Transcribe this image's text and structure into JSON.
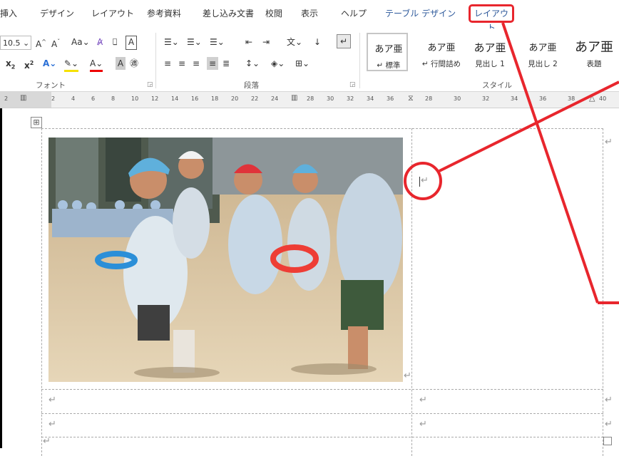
{
  "tabs": {
    "insert": "挿入",
    "design": "デザイン",
    "layout": "レイアウト",
    "references": "参考資料",
    "mailings": "差し込み文書",
    "review": "校閲",
    "view": "表示",
    "help": "ヘルプ",
    "table_design": "テーブル デザイン",
    "table_layout": "レイアウト"
  },
  "ribbon": {
    "font_size": "10.5",
    "font_group": "フォント",
    "paragraph_group": "段落",
    "style_group": "スタイル",
    "case_button": "Aa",
    "grow_font": "A",
    "shrink_font": "A",
    "styles": [
      {
        "sample": "あア亜",
        "name": "↵ 標準"
      },
      {
        "sample": "あア亜",
        "name": "↵ 行間詰め"
      },
      {
        "sample": "あア亜",
        "name": "見出し 1"
      },
      {
        "sample": "あア亜",
        "name": "見出し 2"
      },
      {
        "sample": "あア亜",
        "name": "表題"
      }
    ]
  },
  "ruler": {
    "ticks": [
      "2",
      "2",
      "4",
      "6",
      "8",
      "10",
      "12",
      "14",
      "16",
      "18",
      "20",
      "22",
      "24",
      "28",
      "30",
      "32",
      "34",
      "36",
      "38",
      "40"
    ]
  },
  "document": {
    "para_mark": "↵",
    "table_move_handle": "⊞"
  },
  "colors": {
    "accent": "#2b579a",
    "annotation": "#e8262d"
  }
}
